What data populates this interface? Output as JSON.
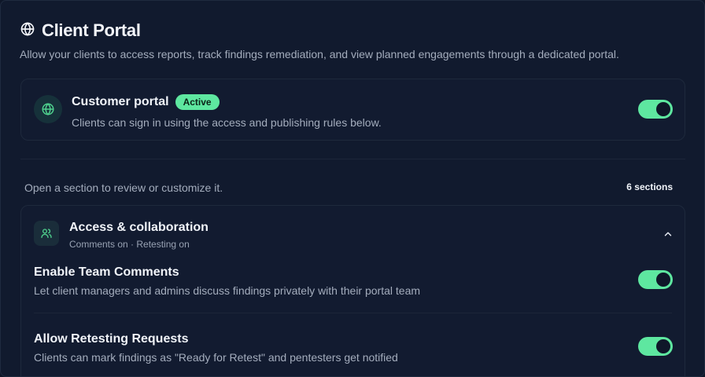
{
  "header": {
    "title": "Client Portal",
    "subtitle": "Allow your clients to access reports, track findings remediation, and view planned engagements through a dedicated portal."
  },
  "portal": {
    "title": "Customer portal",
    "badge": "Active",
    "description": "Clients can sign in using the access and publishing rules below.",
    "enabled": true
  },
  "sections": {
    "info": "Open a section to review or customize it.",
    "count": "6 sections"
  },
  "collaboration": {
    "title": "Access & collaboration",
    "meta": "Comments on · Retesting on",
    "expanded": true,
    "settings": [
      {
        "title": "Enable Team Comments",
        "description": "Let client managers and admins discuss findings privately with their portal team",
        "enabled": true
      },
      {
        "title": "Allow Retesting Requests",
        "description": "Clients can mark findings as \"Ready for Retest\" and pentesters get notified",
        "enabled": true
      }
    ]
  },
  "colors": {
    "background": "#111a2e",
    "accent": "#5ee7a0",
    "muted_text": "#a4adbd"
  }
}
